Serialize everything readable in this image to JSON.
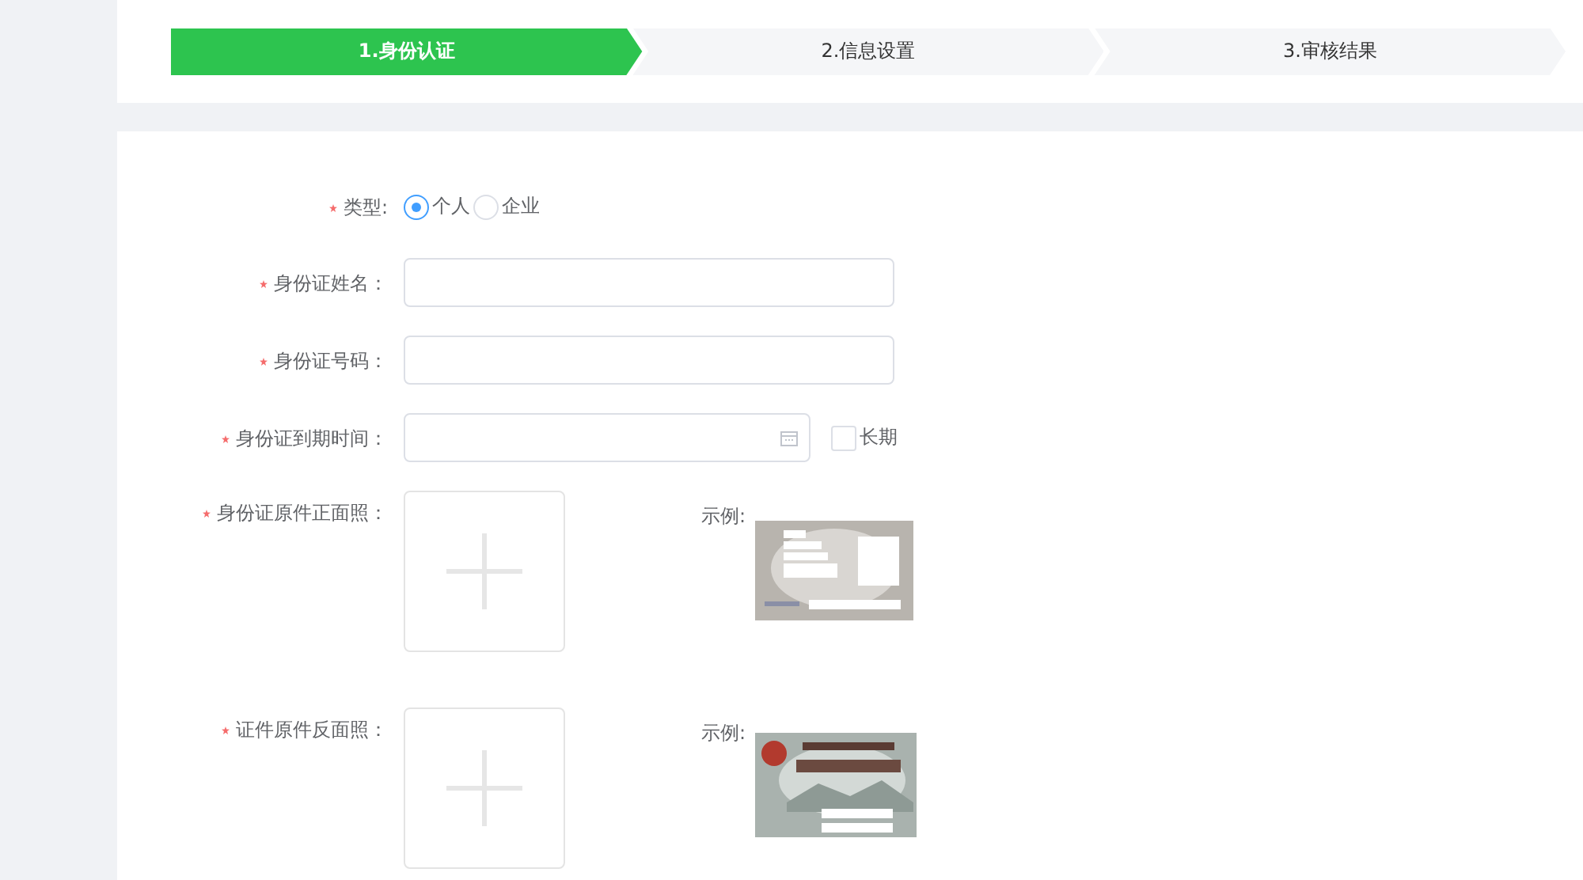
{
  "steps": [
    {
      "label": "1.身份认证",
      "selected": true
    },
    {
      "label": "2.信息设置",
      "selected": false
    },
    {
      "label": "3.审核结果",
      "selected": false
    }
  ],
  "form": {
    "fields": [
      {
        "kind": "radio",
        "label": "类型:",
        "required": true,
        "options": [
          {
            "label": "个人",
            "selected": true
          },
          {
            "label": "企业",
            "selected": false
          }
        ]
      },
      {
        "kind": "text",
        "label": "身份证姓名：",
        "required": true
      },
      {
        "kind": "text",
        "label": "身份证号码：",
        "required": true
      },
      {
        "kind": "date",
        "label": "身份证到期时间：",
        "required": true,
        "checkbox": {
          "label": "长期",
          "checked": false
        }
      },
      {
        "kind": "upload",
        "label": "身份证原件正面照：",
        "required": true,
        "example_label": "示例:"
      },
      {
        "kind": "upload",
        "label": "证件原件反面照：",
        "required": true,
        "example_label": "示例:"
      }
    ]
  }
}
